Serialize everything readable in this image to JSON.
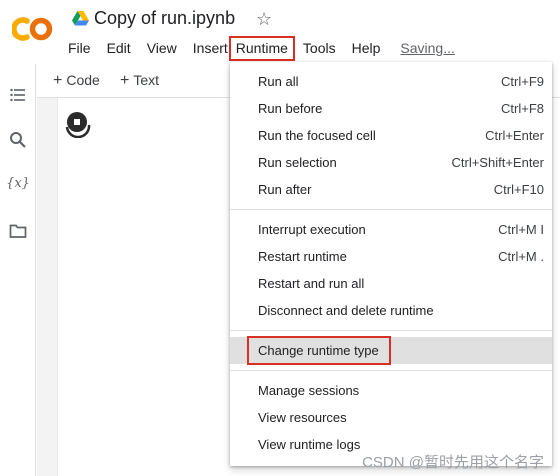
{
  "app": {
    "title": "Copy of run.ipynb"
  },
  "menu": [
    {
      "label": "File"
    },
    {
      "label": "Edit"
    },
    {
      "label": "View"
    },
    {
      "label": "Insert"
    },
    {
      "label": "Runtime"
    },
    {
      "label": "Tools"
    },
    {
      "label": "Help"
    },
    {
      "label": "Saving..."
    }
  ],
  "toolbar": {
    "code_label": "Code",
    "text_label": "Text"
  },
  "rail": {
    "variables_label": "{x}"
  },
  "runtime_menu": {
    "groups": [
      [
        {
          "label": "Run all",
          "shortcut": "Ctrl+F9"
        },
        {
          "label": "Run before",
          "shortcut": "Ctrl+F8"
        },
        {
          "label": "Run the focused cell",
          "shortcut": "Ctrl+Enter"
        },
        {
          "label": "Run selection",
          "shortcut": "Ctrl+Shift+Enter"
        },
        {
          "label": "Run after",
          "shortcut": "Ctrl+F10"
        }
      ],
      [
        {
          "label": "Interrupt execution",
          "shortcut": "Ctrl+M I"
        },
        {
          "label": "Restart runtime",
          "shortcut": "Ctrl+M ."
        },
        {
          "label": "Restart and run all",
          "shortcut": ""
        },
        {
          "label": "Disconnect and delete runtime",
          "shortcut": ""
        }
      ],
      [
        {
          "label": "Change runtime type",
          "shortcut": ""
        }
      ],
      [
        {
          "label": "Manage sessions",
          "shortcut": ""
        },
        {
          "label": "View resources",
          "shortcut": ""
        },
        {
          "label": "View runtime logs",
          "shortcut": ""
        }
      ]
    ]
  },
  "watermark": "CSDN @暂时先用这个名字",
  "colors": {
    "accent_red": "#d93025",
    "logo_orange": "#f9ab00",
    "logo_dark_orange": "#e8710a"
  }
}
